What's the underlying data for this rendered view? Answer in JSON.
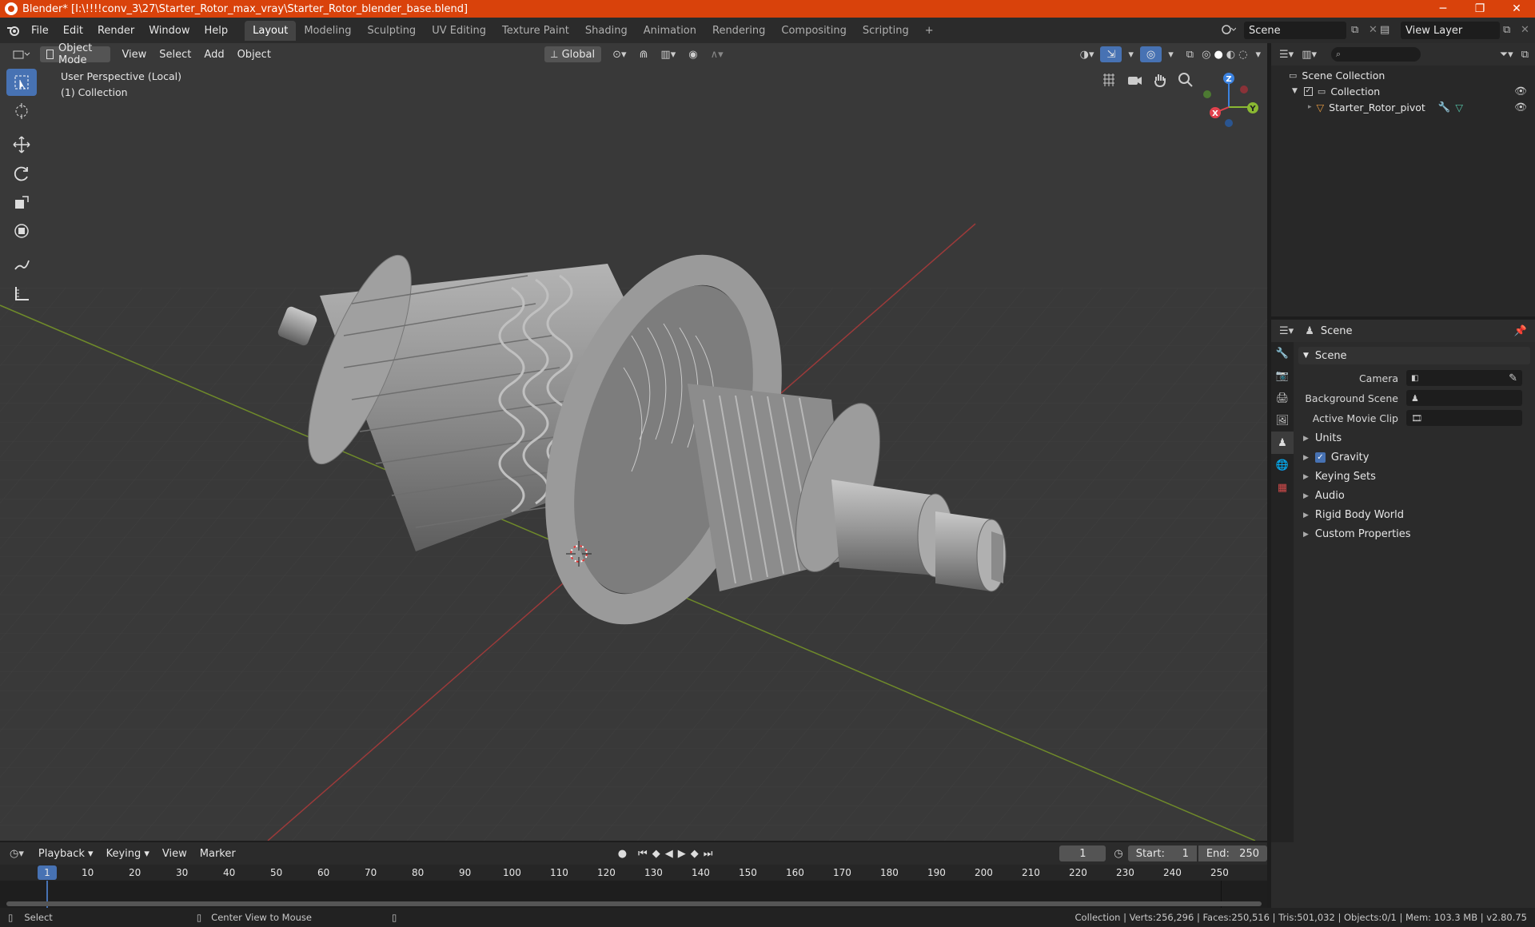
{
  "window": {
    "title": "Blender* [I:\\!!!!conv_3\\27\\Starter_Rotor_max_vray\\Starter_Rotor_blender_base.blend]",
    "minimize": "─",
    "maximize": "❐",
    "close": "✕"
  },
  "menu": [
    "File",
    "Edit",
    "Render",
    "Window",
    "Help"
  ],
  "workspaces": [
    "Layout",
    "Modeling",
    "Sculpting",
    "UV Editing",
    "Texture Paint",
    "Shading",
    "Animation",
    "Rendering",
    "Compositing",
    "Scripting"
  ],
  "workspace_add": "+",
  "scene_name": "Scene",
  "view_layer": "View Layer",
  "viewport": {
    "mode": "Object Mode",
    "menus": [
      "View",
      "Select",
      "Add",
      "Object"
    ],
    "orientation": "Global",
    "info_line1": "User Perspective (Local)",
    "info_line2": "(1) Collection",
    "gizmo": {
      "x": "X",
      "y": "Y",
      "z": "Z"
    }
  },
  "outliner": {
    "root": "Scene Collection",
    "collection": "Collection",
    "object": "Starter_Rotor_pivot"
  },
  "properties": {
    "context": "Scene",
    "panel_title": "Scene",
    "camera_label": "Camera",
    "background_scene_label": "Background Scene",
    "active_movie_clip_label": "Active Movie Clip",
    "sections": [
      "Units",
      "Gravity",
      "Keying Sets",
      "Audio",
      "Rigid Body World",
      "Custom Properties"
    ],
    "gravity_checked": true
  },
  "timeline": {
    "menus": [
      "Playback",
      "Keying",
      "View",
      "Marker"
    ],
    "current_frame": "1",
    "start_label": "Start:",
    "start": "1",
    "end_label": "End:",
    "end": "250",
    "ticks": [
      "1",
      "10",
      "20",
      "30",
      "40",
      "50",
      "60",
      "70",
      "80",
      "90",
      "100",
      "110",
      "120",
      "130",
      "140",
      "150",
      "160",
      "170",
      "180",
      "190",
      "200",
      "210",
      "220",
      "230",
      "240",
      "250"
    ]
  },
  "status": {
    "select": "Select",
    "center": "Center View to Mouse",
    "stats": "Collection | Verts:256,296 | Faces:250,516 | Tris:501,032 | Objects:0/1 | Mem: 103.3 MB | v2.80.75"
  },
  "colors": {
    "titlebar": "#d9420b",
    "active_tool": "#4772b3",
    "axis_x": "#e0424d",
    "axis_y": "#8ab832",
    "axis_z": "#3b82e0"
  }
}
